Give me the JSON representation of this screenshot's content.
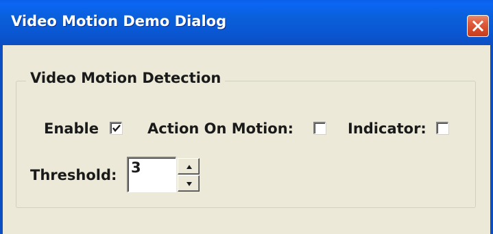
{
  "window": {
    "title": "Video Motion Demo Dialog",
    "close_icon": "close-x-icon"
  },
  "group": {
    "label": "Video Motion Detection"
  },
  "enable": {
    "label": "Enable",
    "checked": true
  },
  "action_on_motion": {
    "label": "Action On Motion:",
    "checked": false
  },
  "indicator": {
    "label": "Indicator:",
    "checked": false
  },
  "threshold": {
    "label": "Threshold:",
    "value": "3",
    "up_icon": "spin-up-arrow-icon",
    "down_icon": "spin-down-arrow-icon"
  },
  "colors": {
    "titlebar": "#0a5fd9",
    "dialog_bg": "#ece9d8",
    "close_button": "#d34a2a"
  }
}
